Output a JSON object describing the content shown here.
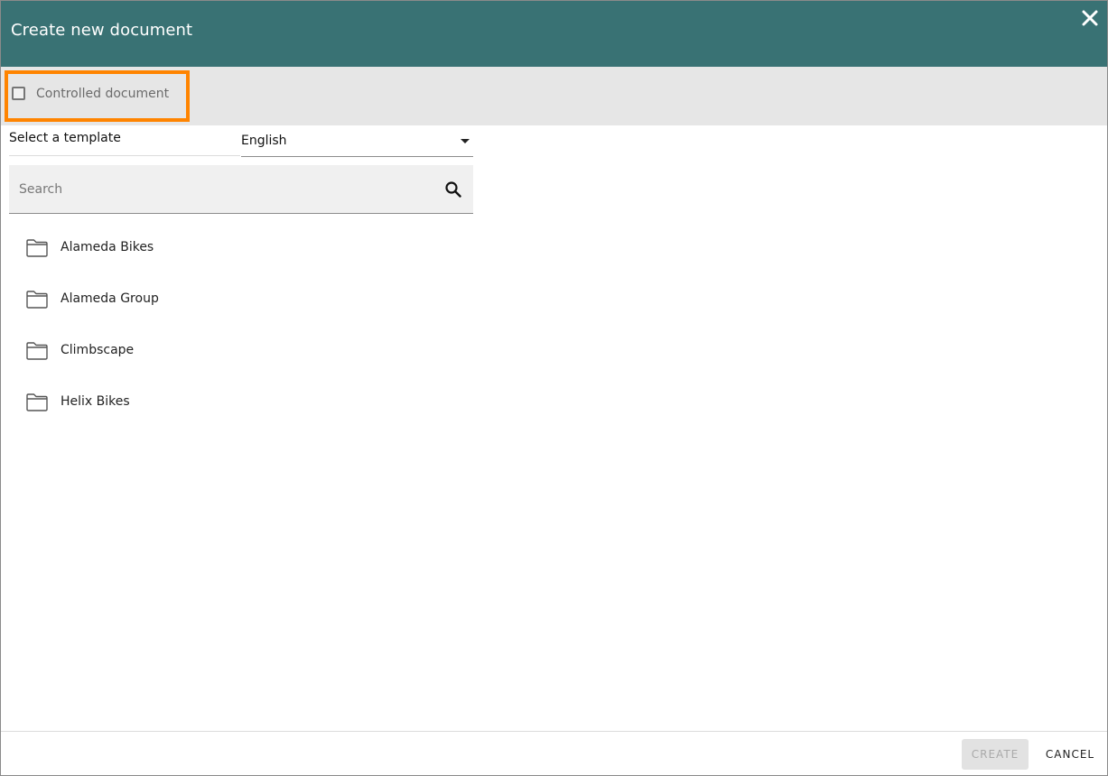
{
  "dialog": {
    "title": "Create new document",
    "close_icon": "close-icon"
  },
  "options": {
    "controlled_label": "Controlled document",
    "controlled_checked": false,
    "highlight_color": "#ff8400"
  },
  "template": {
    "label": "Select a template",
    "language_selected": "English",
    "search_placeholder": "Search"
  },
  "folders": [
    {
      "label": "Alameda Bikes",
      "icon": "folder-icon"
    },
    {
      "label": "Alameda Group",
      "icon": "folder-icon"
    },
    {
      "label": "Climbscape",
      "icon": "folder-icon"
    },
    {
      "label": "Helix Bikes",
      "icon": "folder-icon"
    }
  ],
  "footer": {
    "create_label": "CREATE",
    "create_disabled": true,
    "cancel_label": "CANCEL"
  },
  "colors": {
    "header": "#397274",
    "options_bar": "#e6e6e6"
  }
}
